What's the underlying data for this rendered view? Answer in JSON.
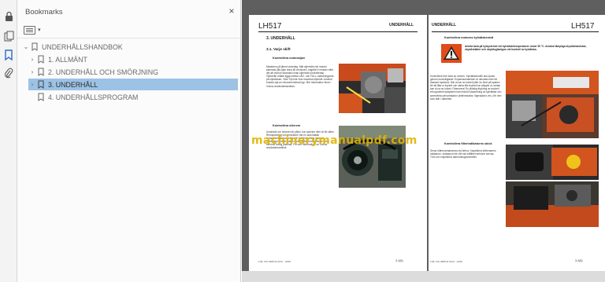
{
  "sidebar": {
    "title": "Bookmarks",
    "close_glyph": "×",
    "items": [
      {
        "label": "UNDERHÅLLSHANDBOK",
        "expanded": true,
        "level": 0
      },
      {
        "label": "1. ALLMÄNT",
        "expanded": false,
        "level": 1
      },
      {
        "label": "2. UNDERHÅLL OCH SMÖRJNING",
        "expanded": false,
        "level": 1
      },
      {
        "label": "3. UNDERHÅLL",
        "expanded": false,
        "level": 1,
        "selected": true
      },
      {
        "label": "4. UNDERHÅLLSPROGRAM",
        "expanded": null,
        "level": 1
      }
    ]
  },
  "rail_icons": [
    "lock-icon",
    "copy-pages-icon",
    "bookmark-icon",
    "attachment-icon"
  ],
  "document": {
    "left_page": {
      "model": "LH517",
      "section": "UNDERHÅLL",
      "heading": "3.    UNDERHÅLL",
      "subheading": "3.1.    Varje skift",
      "bullet1": "Kontrollera motoroljan",
      "text1": "Maskinen på jämnt underlag. Mät oljenivån när motorn stannats (låt oljan rinna till vevhuset i ungefär 5 minuter efter det att motorn stannats innan oljenivån kontrolleras). Oljenivån måste ligga mellan LÅG- och FULL-markeringarna på oljestickan. Obs! Fyll inte över maximal oljenivå. Använd endast olja av rekommenderad typ. Mer information finns i Volvos användarhandbok.",
      "bullet2": "Kontrollera drivrem",
      "text2": "Undersök om remmen är pliten, har sprickor eller är för sliten. Remspänning vid generatorn har en automatisk remspänningsanordning och behöver aldrig justeras. Generatorremmen har en automatisk remspännare och behöver aldrig justeras. För mer information, se Volvos användarhandbok.",
      "footer_left": "Från S/N 2988 till 3210 · 12/08",
      "footer_right": "3-1(8)"
    },
    "right_page": {
      "model": "LH517",
      "section": "UNDERHÅLL",
      "bullet1": "Kontrollera motorns kylvätskenivå",
      "warning": "Arbeta bara på kylsystemet vid kylvätsketemperaturer under 50 °C. Använd lämpliga skyddshandskar, skyddskläder och skyddsglasögon vid kontroll av kylvätska.",
      "text1": "Kontrollera före start av motorn. Kylvätskenivån ska synas genom kontrollglaset. Expansionstanken är utrustad med ett ökasset trycklock. När du tar av locket lyfter du först på spaken för att låta ur trycket och vänta tills trycket har släppts ut, sedan kan du ta av locket. Observera! En plötslig frigöring av trycket i ett uppvärmt kylsystem kan leda till utsprutning av kylvätska och avsevärda personskador (brännskador, lögnskador, etc.) för den som står i närheten.",
      "bullet2": "Kontrollera filterindikatorns skick",
      "text2": "Serva luftrenarmatsenna vid behov. Inspektera luftrenarens indikatorn. Indikatorn blir rött när luftfiltret behöver servas. Töm och inspektera dammutloppsventilen.",
      "footer_left": "Från S/N 2988 till 3210 · 12/08",
      "footer_right": "3-2(8)"
    },
    "watermark": "machinerymanualpdf.com"
  },
  "colors": {
    "selection": "#9cc2e5",
    "doc_background": "#5f5f5f",
    "warning_triangle": "#e04c1a",
    "machine_orange": "#d9531e",
    "watermark": "#e1b400"
  }
}
